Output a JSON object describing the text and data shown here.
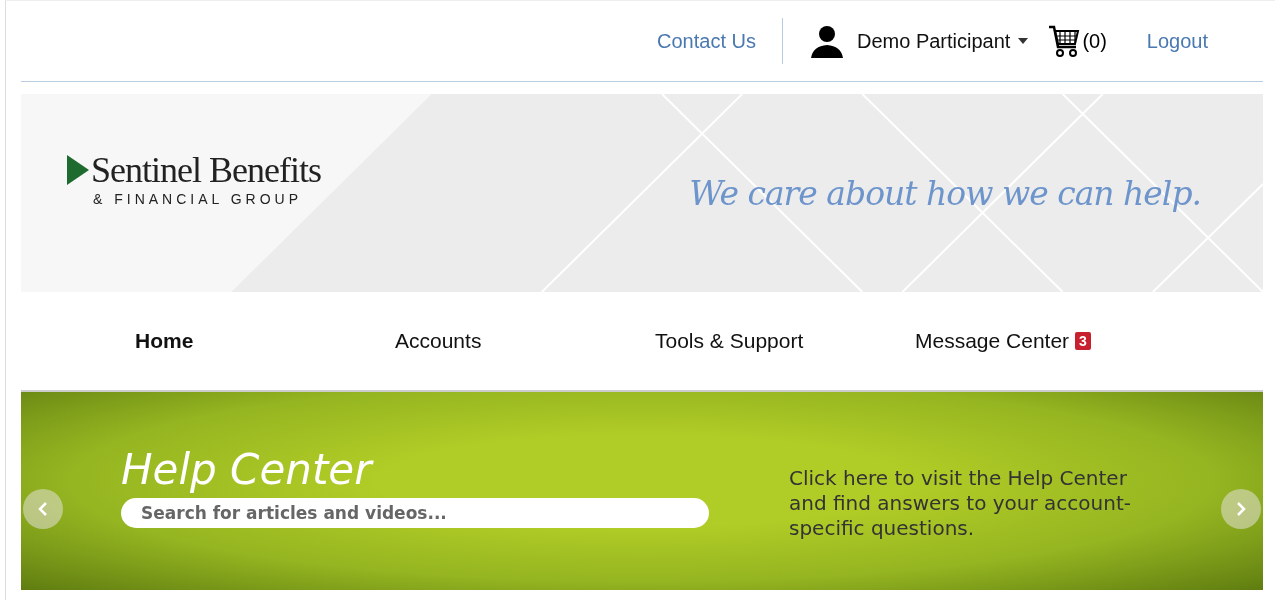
{
  "header": {
    "contact": "Contact Us",
    "user": "Demo Participant",
    "cart": "(0)",
    "logout": "Logout"
  },
  "brand": {
    "name": "Sentinel Benefits",
    "subtitle": "& FINANCIAL GROUP",
    "slogan": "We care about how we can help."
  },
  "nav": [
    {
      "label": "Home",
      "selected": true
    },
    {
      "label": "Accounts",
      "selected": false
    },
    {
      "label": "Tools & Support",
      "selected": false
    },
    {
      "label": "Message Center",
      "selected": false,
      "badge": "3"
    }
  ],
  "promo": {
    "title": "Help Center",
    "search": {
      "placeholder": "Search for articles and videos..."
    },
    "text": "Click here to visit the Help Center and find answers to your account-specific questions."
  }
}
